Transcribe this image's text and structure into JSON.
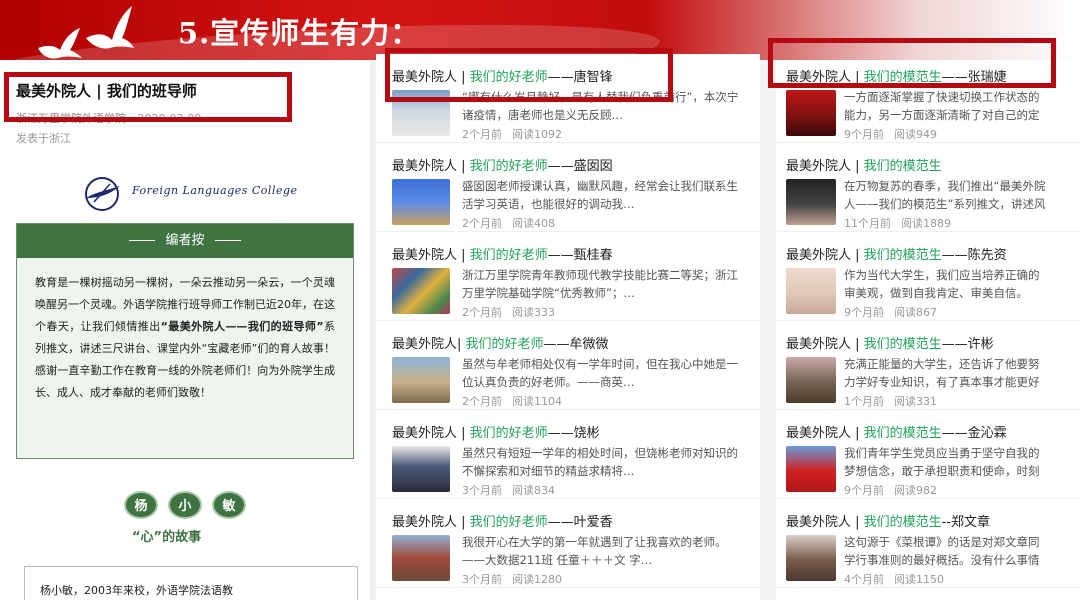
{
  "banner": {
    "title": "5.宣传师生有力："
  },
  "article": {
    "title": "最美外院人 | 我们的班导师",
    "meta": "浙江万里学院外语学院",
    "date": "2020-03-09",
    "posted_from": "发表于浙江",
    "college_logo_text": "Foreign Languages College",
    "editor_note_header": "编者按",
    "editor_note_p1": "教育是一棵树摇动另一棵树，一朵云推动另一朵云，一个灵魂唤醒另一个灵魂。外语学院推行班导师工作制已近20年，在这个春天，让我们倾情推出",
    "editor_note_bold": "“最美外院人——我们的班导师”",
    "editor_note_p2": "系列推文，讲述三尺讲台、课堂内外“宝藏老师”们的育人故事！感谢一直辛勤工作在教育一线的外院老师们！向为外院学生成长、成人、成才奉献的老师们致敬！",
    "name_chars": [
      "杨",
      "小",
      "敏"
    ],
    "heart_story_title": "“心”的故事",
    "story_start": "杨小敏，2003年来校，外语学院法语教"
  },
  "teachers": {
    "items": [
      {
        "prefix": "最美外院人 | ",
        "cat": "我们的好老师",
        "name": "——唐智锋",
        "desc": "“哪有什么岁月静好，是有人替我们负重前行”，本次宁诸疫情，唐老师也是义无反顾…",
        "time": "2个月前",
        "reads": "阅读1092"
      },
      {
        "prefix": "最美外院人 | ",
        "cat": "我们的好老师",
        "name": "——盛囡囡",
        "desc": "盛囡囡老师授课认真，幽默风趣，经常会让我们联系生活学习英语，也能很好的调动我…",
        "time": "2个月前",
        "reads": "阅读408"
      },
      {
        "prefix": "最美外院人 | ",
        "cat": "我们的好老师",
        "name": "——甄桂春",
        "desc": "浙江万里学院青年教师现代教学技能比赛二等奖；浙江万里学院基础学院“优秀教师”；…",
        "time": "2个月前",
        "reads": "阅读333"
      },
      {
        "prefix": "最美外院人| ",
        "cat": "我们的好老师",
        "name": "——牟微微",
        "desc": "虽然与牟老师相处仅有一学年时间，但在我心中她是一位认真负责的好老师。——商英…",
        "time": "2个月前",
        "reads": "阅读1104"
      },
      {
        "prefix": "最美外院人 | ",
        "cat": "我们的好老师",
        "name": "——饶彬",
        "desc": "虽然只有短短一学年的相处时间，但饶彬老师对知识的不懈探索和对细节的精益求精将…",
        "time": "3个月前",
        "reads": "阅读834"
      },
      {
        "prefix": "最美外院人 | ",
        "cat": "我们的好老师",
        "name": "——叶爱香",
        "desc": "我很开心在大学的第一年就遇到了让我喜欢的老师。——大数据211班 任童＋＋＋文 字…",
        "time": "3个月前",
        "reads": "阅读1280"
      }
    ]
  },
  "students": {
    "items": [
      {
        "prefix": "最美外院人 | ",
        "cat": "我们的模范生",
        "name": "——张瑞婕",
        "desc": "一方面逐渐掌握了快速切换工作状态的能力，另一方面逐渐清晰了对自己的定位：提…",
        "time": "9个月前",
        "reads": "阅读949"
      },
      {
        "prefix": "最美外院人 | ",
        "cat": "我们的模范生",
        "name": "",
        "desc": "在万物复苏的春季，我们推出“最美外院人——我们的模范生”系列推文，讲述风华正…",
        "time": "11个月前",
        "reads": "阅读1889"
      },
      {
        "prefix": "最美外院人 | ",
        "cat": "我们的模范生",
        "name": "——陈先资",
        "desc": "作为当代大学生，我们应当培养正确的审美观，做到自我肯定、审美自信。美，不只是…",
        "time": "9个月前",
        "reads": "阅读867"
      },
      {
        "prefix": "最美外院人 | ",
        "cat": "我们的模范生",
        "name": "——许彬",
        "desc": "充满正能量的大学生，还告诉了他要努力学好专业知识，有了真本事才能更好地为社会…",
        "time": "1个月前",
        "reads": "阅读331"
      },
      {
        "prefix": "最美外院人 | ",
        "cat": "我们的模范生",
        "name": "——金沁霖",
        "desc": "我们青年学生党员应当勇于坚守自我的梦想信念，敢于承担职责和使命，时刻发挥党员…",
        "time": "9个月前",
        "reads": "阅读982"
      },
      {
        "prefix": "最美外院人 | ",
        "cat": "我们的模范生",
        "name": "--郑文章",
        "desc": "这句源于《菜根谭》的话是对郑文章同学行事准则的最好概括。没有什么事情是可以一…",
        "time": "4个月前",
        "reads": "阅读1150"
      }
    ]
  },
  "colors": {
    "banner_red": "#c20d0d",
    "highlight_border": "#b50a12",
    "green_accent": "#21a35a",
    "note_green": "#3f7342"
  }
}
